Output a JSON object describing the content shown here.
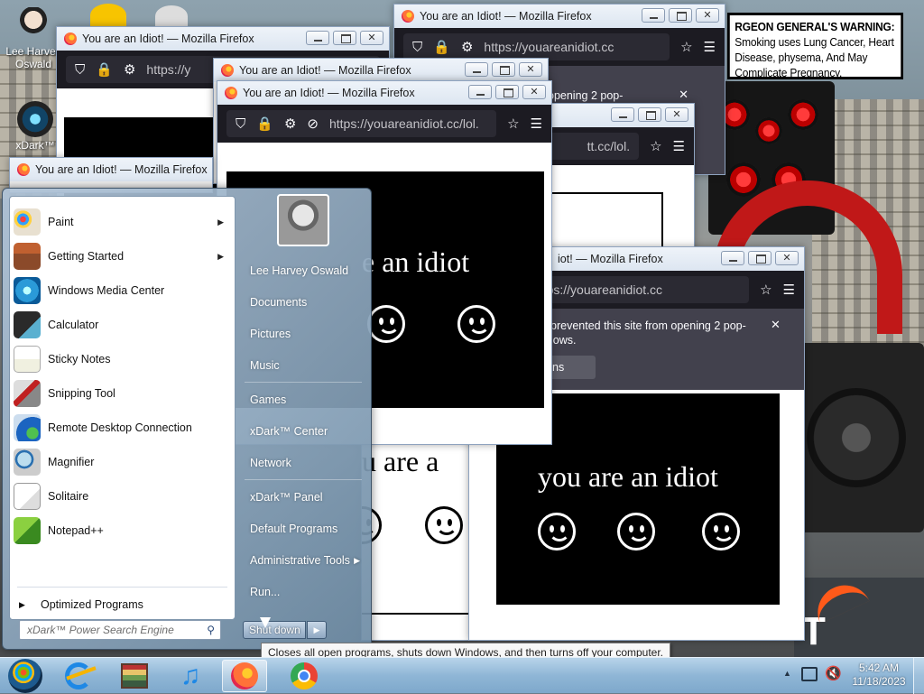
{
  "desktop": {
    "icons": [
      {
        "label": "Lee Harvey Oswald"
      },
      {
        "label": "xDark™"
      }
    ],
    "warning": {
      "bold": "RGEON GENERAL'S WARNING:",
      "text": " Smoking uses Lung Cancer, Heart Disease, physema, And May Complicate Pregnancy."
    }
  },
  "firefox": {
    "window_title": "You are an Idiot! — Mozilla Firefox",
    "window_title_partial": "iot! — Mozilla Firefox",
    "url": "https://youareanidiot.cc/lol.",
    "url_short": "https://youareanidiot.cc",
    "url_tiny": "https://y",
    "url_fragment": "tt.cc/lol.",
    "page_text": "you are an idiot",
    "page_text_partial_1": "e an idiot",
    "page_text_partial_2": "u are a",
    "notification_1": "prevented this site from opening 2 pop-",
    "notification_2": "lows.",
    "notification_button": "ns",
    "notification_top": "opening 2 pop-"
  },
  "start_menu": {
    "programs": [
      {
        "label": "Paint",
        "icon": "paint-icon",
        "submenu": true
      },
      {
        "label": "Getting Started",
        "icon": "getting-started-icon",
        "submenu": true
      },
      {
        "label": "Windows Media Center",
        "icon": "media-center-icon",
        "submenu": false
      },
      {
        "label": "Calculator",
        "icon": "calculator-icon",
        "submenu": false
      },
      {
        "label": "Sticky Notes",
        "icon": "sticky-notes-icon",
        "submenu": false
      },
      {
        "label": "Snipping Tool",
        "icon": "snipping-tool-icon",
        "submenu": false
      },
      {
        "label": "Remote Desktop Connection",
        "icon": "remote-desktop-icon",
        "submenu": false
      },
      {
        "label": "Magnifier",
        "icon": "magnifier-icon",
        "submenu": false
      },
      {
        "label": "Solitaire",
        "icon": "solitaire-icon",
        "submenu": false
      },
      {
        "label": "Notepad++",
        "icon": "notepad-plus-plus-icon",
        "submenu": false
      }
    ],
    "all_programs": "Optimized Programs",
    "search_placeholder": "xDark™ Power Search Engine",
    "right_links": [
      "Lee Harvey Oswald",
      "Documents",
      "Pictures",
      "Music",
      "Games",
      "xDark™ Center",
      "Network",
      "xDark™ Panel",
      "Default Programs",
      "Administrative Tools",
      "Run..."
    ],
    "shutdown_label": "Shut down",
    "tooltip": "Closes all open programs, shuts down Windows, and then turns off your computer."
  },
  "taskbar": {
    "time": "5:42 AM",
    "date": "11/18/2023",
    "items": [
      "start-orb",
      "internet-explorer-icon",
      "library-icon",
      "itunes-icon",
      "firefox-icon",
      "chrome-icon"
    ]
  }
}
